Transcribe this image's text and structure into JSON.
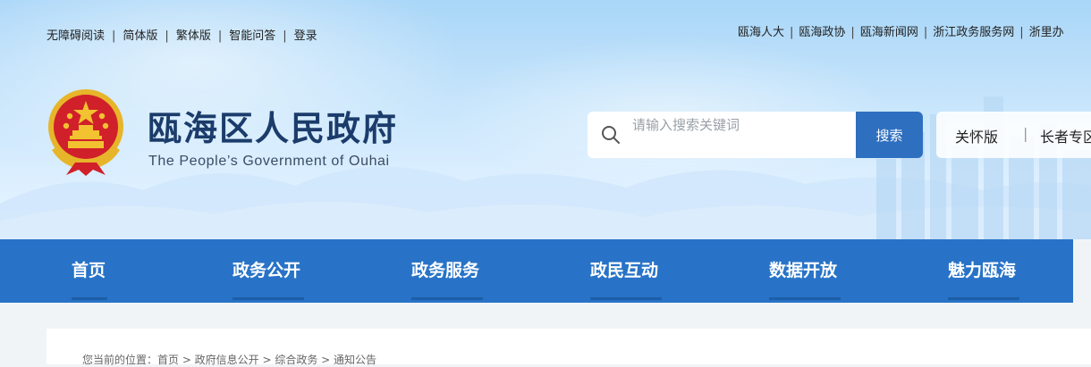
{
  "top_left_links": [
    "无障碍阅读",
    "简体版",
    "繁体版",
    "智能问答",
    "登录"
  ],
  "top_right_links": [
    "瓯海人大",
    "瓯海政协",
    "瓯海新闻网",
    "浙江政务服务网",
    "浙里办"
  ],
  "site": {
    "title": "瓯海区人民政府",
    "subtitle": "The People’s Government of Ouhai"
  },
  "search": {
    "placeholder": "请输入搜索关键词",
    "button_label": "搜索"
  },
  "modes": [
    "关怀版",
    "长者专区"
  ],
  "nav": [
    "首页",
    "政务公开",
    "政务服务",
    "政民互动",
    "数据开放",
    "魅力瓯海"
  ],
  "breadcrumb": "您当前的位置：首页 > 政府信息公开 > 综合政务 > 通知公告",
  "colors": {
    "nav_bg": "#2873c7",
    "search_button": "#2e6fc0",
    "title": "#1b3c6b",
    "emblem_red": "#d0202a",
    "emblem_gold": "#f2c230"
  },
  "icons": [
    "national-emblem-icon",
    "search-icon"
  ]
}
